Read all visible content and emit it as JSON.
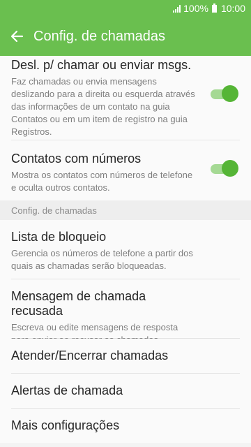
{
  "status": {
    "battery_text": "100%",
    "time": "10:00"
  },
  "header": {
    "title": "Config. de chamadas"
  },
  "items": [
    {
      "title": "Desl. p/ chamar ou enviar msgs.",
      "subtitle": "Faz chamadas ou envia mensagens deslizando para a direita ou esquerda através das informações de um contato na guia Contatos ou em um item de registro na guia Registros.",
      "toggle_on": true
    },
    {
      "title": "Contatos com números",
      "subtitle": "Mostra os contatos com números de telefone e oculta outros contatos.",
      "toggle_on": true
    }
  ],
  "section": {
    "label": "Config. de chamadas"
  },
  "section_items": [
    {
      "title": "Lista de bloqueio",
      "subtitle": "Gerencia os números de telefone a partir dos quais as chamadas serão bloqueadas."
    },
    {
      "title": "Mensagem de chamada recusada",
      "subtitle": "Escreva ou edite mensagens de resposta para enviar ao recusar as chamadas recebidas."
    },
    {
      "title": "Atender/Encerrar chamadas"
    },
    {
      "title": "Alertas de chamada"
    },
    {
      "title": "Mais configurações"
    }
  ],
  "colors": {
    "accent": "#6abf4f",
    "toggle_on": "#55b536"
  }
}
